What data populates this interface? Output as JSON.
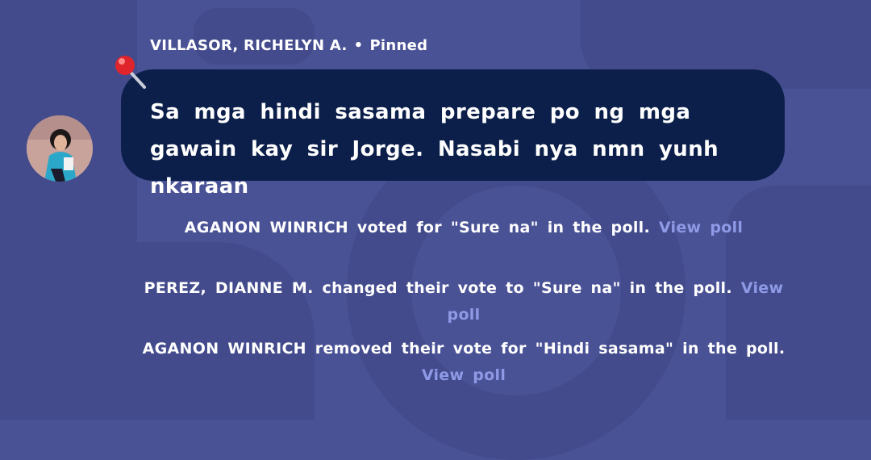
{
  "message": {
    "sender": "VILLASOR, RICHELYN A.",
    "separator": "•",
    "status": "Pinned",
    "text": "Sa mga hindi sasama prepare po ng mga gawain kay sir Jorge. Nasabi nya nmn yunh nkaraan"
  },
  "events": [
    {
      "text": "AGANON WINRICH voted for \"Sure na\" in the poll.",
      "link": "View poll"
    },
    {
      "text": "PEREZ, DIANNE M. changed their vote to \"Sure na\" in the poll.",
      "link": "View poll"
    },
    {
      "text": "AGANON WINRICH removed their vote for \"Hindi sasama\" in the poll.",
      "link": "View poll"
    }
  ],
  "icons": {
    "pin": "pushpin-icon",
    "avatar": "user-avatar"
  },
  "colors": {
    "background": "#4a5296",
    "bubble": "#0b1f4a",
    "link": "#8f9ae6"
  }
}
